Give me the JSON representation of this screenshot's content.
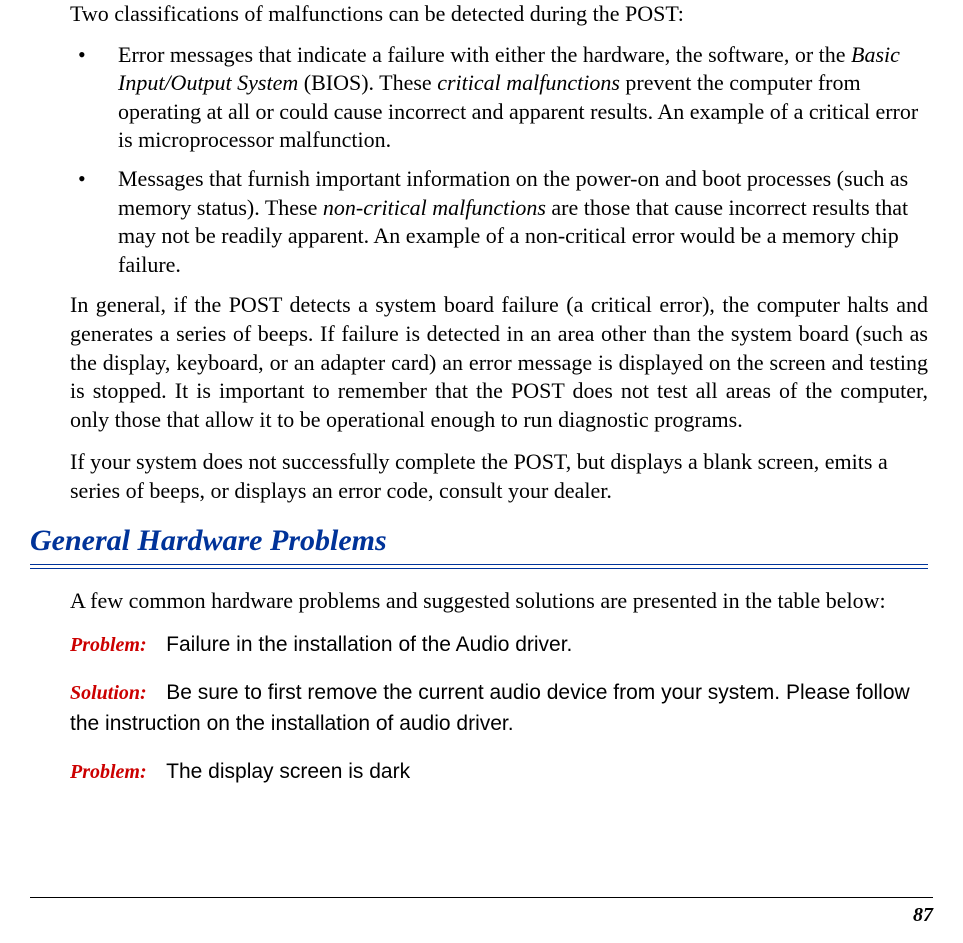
{
  "intro": "Two classifications of malfunctions can be detected during the POST:",
  "bullets": [
    {
      "pre": "Error messages that indicate a failure with either the hardware, the software, or the ",
      "italic1": "Basic Input/Output System",
      "mid": " (BIOS). These ",
      "italic2": "critical malfunctions",
      "post": " prevent the computer from operating at all or could cause incorrect and apparent results. An example of a critical error is microprocessor malfunction."
    },
    {
      "pre": "Messages that furnish important information on the power-on and boot processes (such as memory status). These ",
      "italic1": "non-critical malfunctions",
      "mid": "",
      "italic2": "",
      "post": " are those that cause incorrect results that may not be readily apparent. An example of a non-critical error would be a memory chip failure."
    }
  ],
  "para1": "In general, if the POST detects a system board failure (a critical error), the computer halts and generates a series of beeps. If failure is detected in an area other than the system board (such as the display, keyboard, or an adapter card) an error message is displayed on the screen and testing is stopped. It is important to remember that the POST does not test all areas of the computer, only those that allow it to be operational enough to run diagnostic programs.",
  "para2": "If your system does not successfully complete the POST, but displays a blank screen, emits a series of beeps, or displays an error code, consult your dealer.",
  "sectionHeading": "General Hardware Problems",
  "tableIntro": "A few common hardware problems and suggested solutions are presented in the table below:",
  "labels": {
    "problem": "Problem:",
    "solution": "Solution:"
  },
  "items": [
    {
      "type": "problem",
      "text": "Failure in the installation of the Audio driver."
    },
    {
      "type": "solution",
      "text": "Be sure to first remove the current audio device from your system. Please follow the instruction on the installation of audio driver."
    },
    {
      "type": "problem",
      "text": "The display screen is dark"
    }
  ],
  "pageNumber": "87"
}
